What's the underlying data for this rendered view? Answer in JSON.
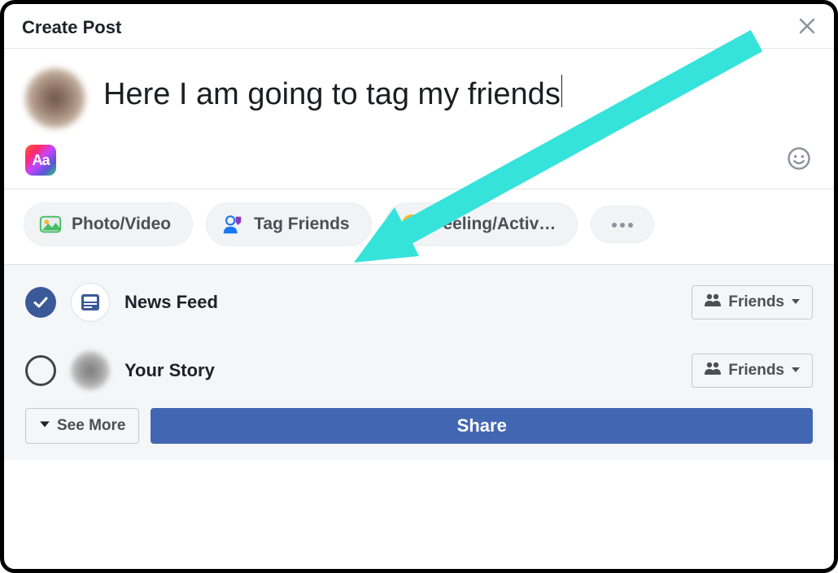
{
  "header": {
    "title": "Create Post"
  },
  "compose": {
    "text": "Here I am going to tag my friends"
  },
  "tools": {
    "background_label": "Aa"
  },
  "pills": {
    "photo_video": "Photo/Video",
    "tag_friends": "Tag Friends",
    "feeling_activity": "Feeling/Activ…"
  },
  "destinations": {
    "news_feed": {
      "label": "News Feed",
      "audience": "Friends"
    },
    "your_story": {
      "label": "Your Story",
      "audience": "Friends"
    }
  },
  "footer": {
    "see_more": "See More",
    "share": "Share"
  }
}
